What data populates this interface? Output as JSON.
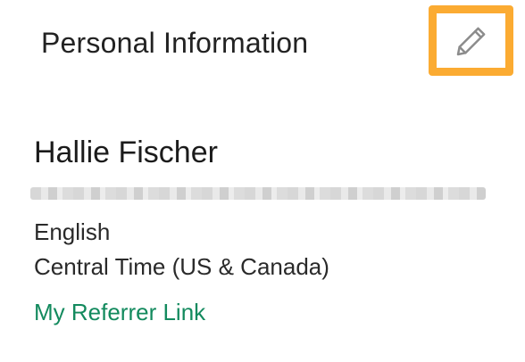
{
  "section": {
    "title": "Personal Information"
  },
  "edit_button": {
    "icon": "pencil-icon",
    "highlight_color": "#fbab32"
  },
  "profile": {
    "full_name": "Hallie Fischer",
    "language": "English",
    "time_zone": "Central Time (US & Canada)",
    "referrer_link_label": "My Referrer Link"
  },
  "colors": {
    "link": "#138a5e",
    "text": "#222222"
  }
}
